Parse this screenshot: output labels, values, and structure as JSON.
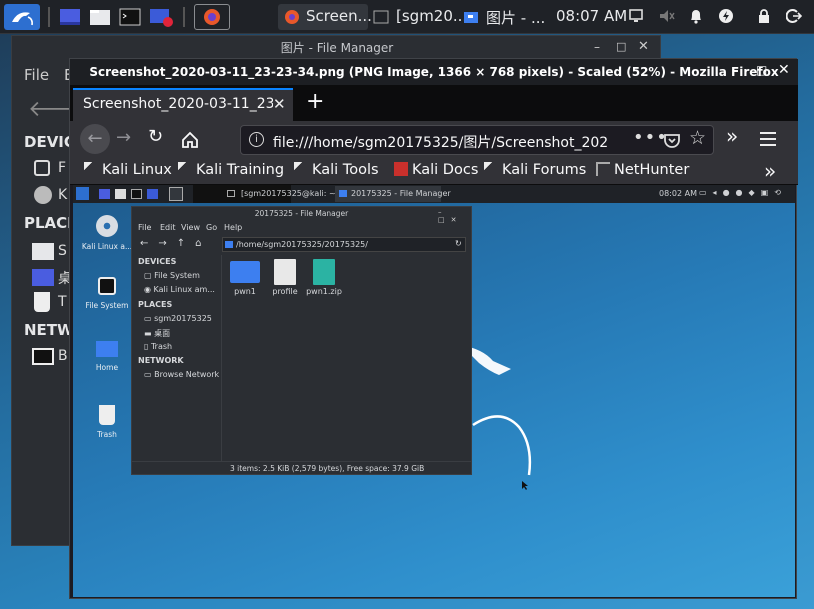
{
  "panel": {
    "task_firefox_title": "Screen...",
    "task_terminal_title": "[sgm20...",
    "task_fm_title": "图片 - ...",
    "clock": "08:07 AM"
  },
  "back_fm": {
    "title": "图片 - File Manager",
    "menu_file": "File",
    "menu_edit_partial": "E",
    "devices_label": "DEVIC",
    "places_label": "PLACE",
    "network_label": "NETW",
    "item1": "F",
    "item2": "K",
    "item3": "S",
    "item4": "桌",
    "item5": "T",
    "item6": "B"
  },
  "firefox": {
    "window_title": "Screenshot_2020-03-11_23-23-34.png (PNG Image, 1366 × 768 pixels) - Scaled (52%) - Mozilla Firefox",
    "tab_label": "Screenshot_2020-03-11_23",
    "url": "file:///home/sgm20175325/图片/Screenshot_202",
    "bookmarks": [
      "Kali Linux",
      "Kali Training",
      "Kali Tools",
      "Kali Docs",
      "Kali Forums",
      "NetHunter"
    ]
  },
  "inner": {
    "task_terminal": "[sgm20175325@kali: ~]",
    "task_fm": "20175325 - File Manager",
    "clock": "08:02 AM",
    "desktop_icons": [
      "Kali Linux a...",
      "File System",
      "Home",
      "Trash"
    ],
    "fm": {
      "title": "20175325 - File Manager",
      "menus": [
        "File",
        "Edit",
        "View",
        "Go",
        "Help"
      ],
      "path": "/home/sgm20175325/20175325/",
      "devices_label": "DEVICES",
      "dev_filesystem": "File System",
      "dev_kali": "Kali Linux am...",
      "places_label": "PLACES",
      "place_home": "sgm20175325",
      "place_desktop": "桌面",
      "place_trash": "Trash",
      "network_label": "NETWORK",
      "net_browse": "Browse Network",
      "files": [
        "pwn1",
        "profile",
        "pwn1.zip"
      ],
      "status": "3 items: 2.5 KiB (2,579 bytes), Free space: 37.9 GiB"
    }
  },
  "colors": {
    "panel_bg": "#1f2227",
    "accent": "#0a84ff",
    "folder": "#3d7ff0",
    "zip": "#2bb3a3"
  }
}
